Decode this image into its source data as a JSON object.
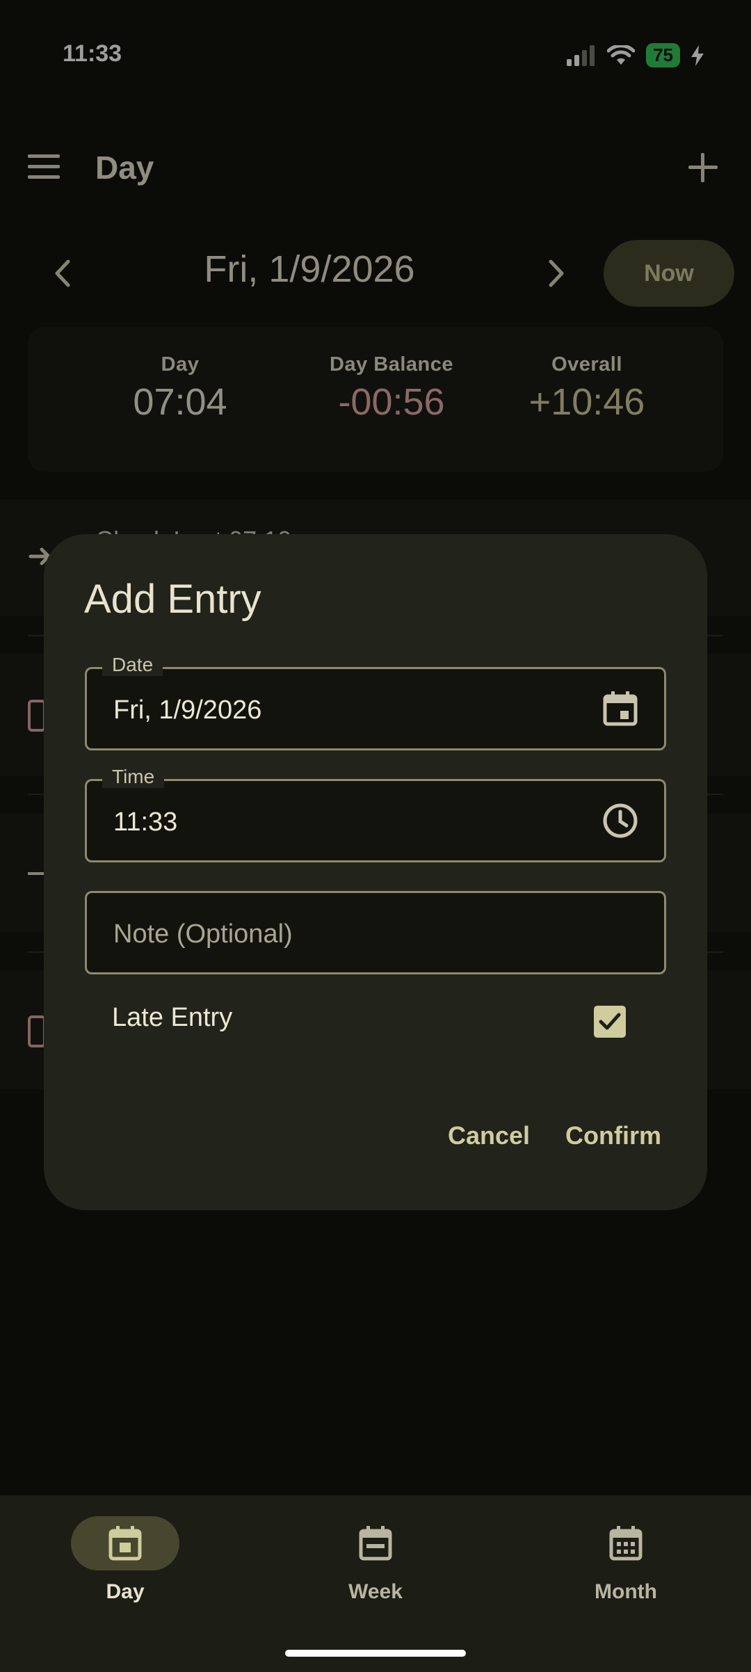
{
  "status_bar": {
    "time": "11:33",
    "battery": "75"
  },
  "header": {
    "title": "Day"
  },
  "date_nav": {
    "date": "Fri, 1/9/2026",
    "now_label": "Now"
  },
  "summary": {
    "day": {
      "label": "Day",
      "value": "07:04"
    },
    "day_balance": {
      "label": "Day Balance",
      "value": "-00:56"
    },
    "overall": {
      "label": "Overall",
      "value": "+10:46"
    }
  },
  "background_list": {
    "first_row_text": "Check In at 07:10"
  },
  "dialog": {
    "title": "Add Entry",
    "date_field": {
      "label": "Date",
      "value": "Fri, 1/9/2026"
    },
    "time_field": {
      "label": "Time",
      "value": "11:33"
    },
    "note_field": {
      "placeholder": "Note (Optional)"
    },
    "late_entry": {
      "label": "Late Entry",
      "checked": true
    },
    "cancel_label": "Cancel",
    "confirm_label": "Confirm"
  },
  "bottom_nav": {
    "items": [
      {
        "label": "Day",
        "icon": "calendar-day-icon",
        "selected": true
      },
      {
        "label": "Week",
        "icon": "calendar-week-icon",
        "selected": false
      },
      {
        "label": "Month",
        "icon": "calendar-month-icon",
        "selected": false
      }
    ]
  },
  "colors": {
    "background": "#12130d",
    "surface": "#22231b",
    "accent": "#cfcc9e",
    "negative": "#e0a9a6",
    "positive": "#cfcc9e"
  }
}
